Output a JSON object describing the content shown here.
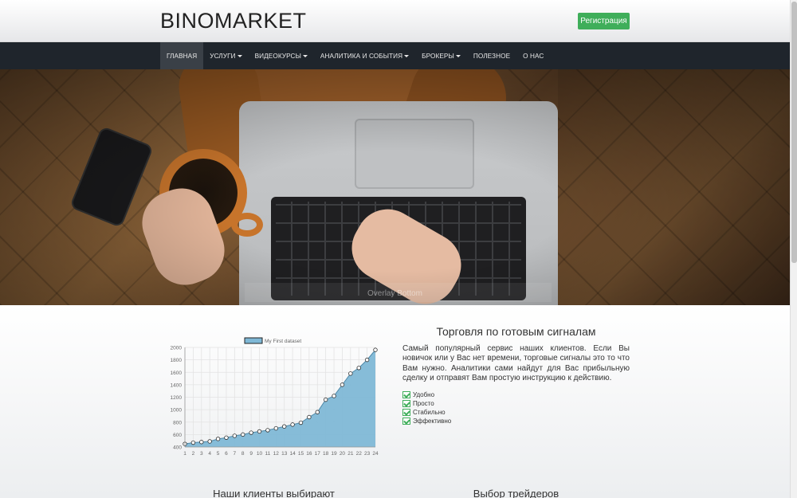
{
  "header": {
    "logo": "BINOMARKET",
    "register_label": "Регистрация"
  },
  "nav": {
    "items": [
      {
        "label": "ГЛАВНАЯ",
        "dropdown": false,
        "active": true
      },
      {
        "label": "УСЛУГИ",
        "dropdown": true,
        "active": false
      },
      {
        "label": "ВИДЕОКУРСЫ",
        "dropdown": true,
        "active": false
      },
      {
        "label": "АНАЛИТИКА И СОБЫТИЯ",
        "dropdown": true,
        "active": false
      },
      {
        "label": "БРОКЕРЫ",
        "dropdown": true,
        "active": false
      },
      {
        "label": "ПОЛЕЗНОЕ",
        "dropdown": false,
        "active": false
      },
      {
        "label": "О НАС",
        "dropdown": false,
        "active": false
      }
    ]
  },
  "hero": {
    "caption": "Overlay Bottom"
  },
  "signals": {
    "title": "Торговля по готовым сигналам",
    "text": "Самый популярный сервис наших клиентов. Если Вы новичок или у Вас нет времени, торговые сигналы это то что Вам нужно. Аналитики сами найдут для Вас прибыльную сделку и отправят Вам простую инструкцию к действию.",
    "features": [
      "Удобно",
      "Просто",
      "Стабильно",
      "Эффективно"
    ]
  },
  "sections": {
    "clients_title": "Наши клиенты выбирают",
    "traders_title": "Выбор трейдеров"
  },
  "colors": {
    "accent_green": "#3fae5a",
    "nav_bg": "#1f252c",
    "chart_fill": "#7fb8d6",
    "chart_line": "#4e88a8"
  },
  "chart_data": {
    "type": "area",
    "legend": [
      "My First dataset"
    ],
    "categories": [
      "1",
      "2",
      "3",
      "4",
      "5",
      "6",
      "7",
      "8",
      "9",
      "10",
      "11",
      "12",
      "13",
      "14",
      "15",
      "16",
      "17",
      "18",
      "19",
      "20",
      "21",
      "22",
      "23",
      "24"
    ],
    "series": [
      {
        "name": "My First dataset",
        "values": [
          450,
          470,
          480,
          490,
          530,
          550,
          580,
          600,
          630,
          650,
          670,
          700,
          730,
          760,
          790,
          880,
          960,
          1160,
          1220,
          1400,
          1580,
          1670,
          1800,
          1960
        ]
      }
    ],
    "ylim": [
      400,
      2000
    ],
    "yticks": [
      400,
      600,
      800,
      1000,
      1200,
      1400,
      1600,
      1800,
      2000
    ],
    "grid": true,
    "legend_position": "top"
  }
}
